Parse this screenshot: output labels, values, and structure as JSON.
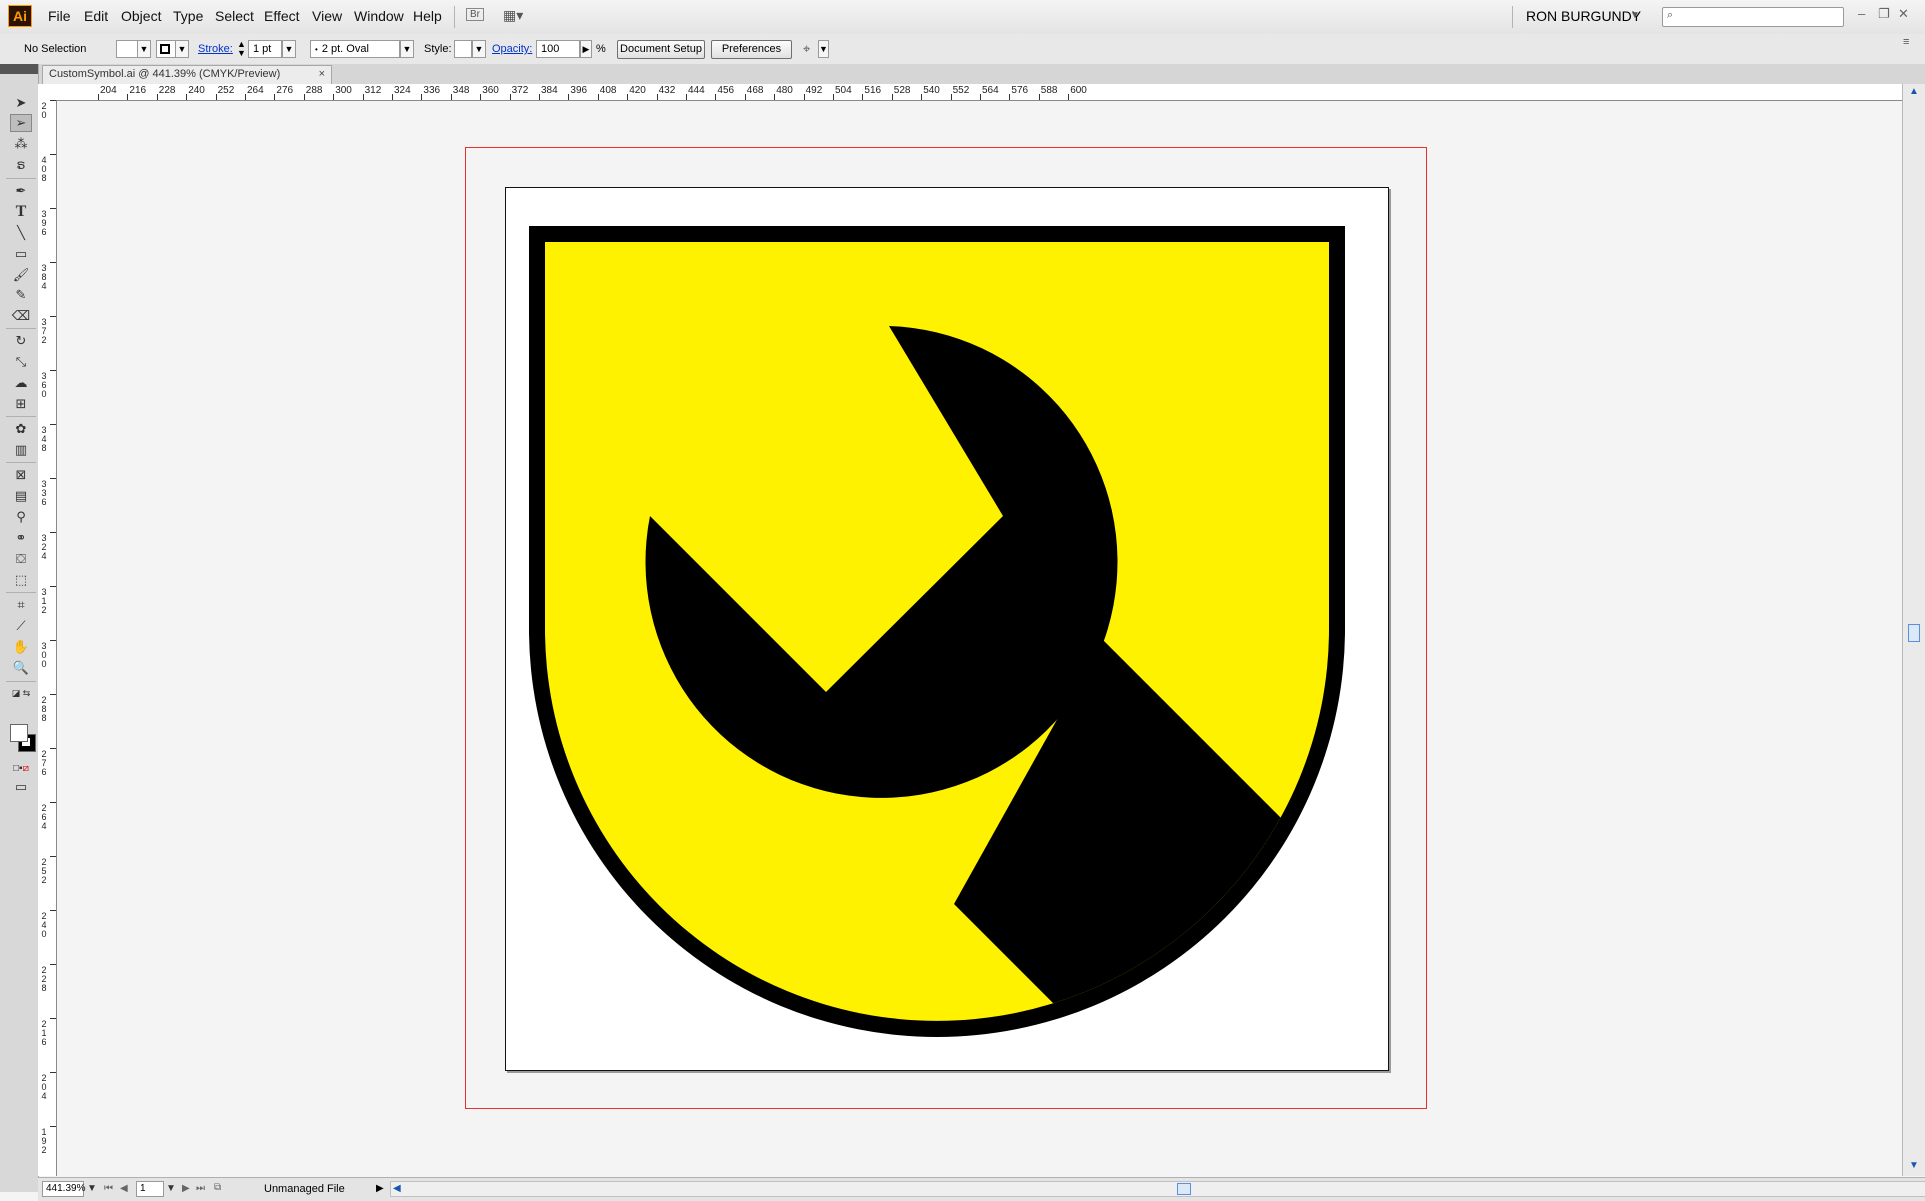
{
  "app": {
    "logo_text": "Ai",
    "menu": [
      "File",
      "Edit",
      "Object",
      "Type",
      "Select",
      "Effect",
      "View",
      "Window",
      "Help"
    ],
    "user_name": "RON BURGUNDY",
    "search_placeholder": ""
  },
  "control_bar": {
    "selection_label": "No Selection",
    "stroke_label": "Stroke:",
    "stroke_value": "1 pt",
    "brush_value": "2 pt. Oval",
    "style_label": "Style:",
    "opacity_label": "Opacity:",
    "opacity_value": "100",
    "percent": "%",
    "document_setup": "Document Setup",
    "preferences": "Preferences"
  },
  "document": {
    "tab_title": "CustomSymbol.ai @ 441.39% (CMYK/Preview)",
    "close_glyph": "×"
  },
  "ruler": {
    "h_ticks": [
      "204",
      "216",
      "228",
      "240",
      "252",
      "264",
      "276",
      "288",
      "300",
      "312",
      "324",
      "336",
      "348",
      "360",
      "372",
      "384",
      "396",
      "408",
      "420",
      "432",
      "444",
      "456",
      "468",
      "480",
      "492",
      "504",
      "516",
      "528",
      "540",
      "552",
      "564",
      "576",
      "588",
      "600"
    ],
    "v_ticks": [
      "20",
      "408",
      "396",
      "384",
      "372",
      "360",
      "348",
      "336",
      "324",
      "312",
      "300",
      "288",
      "276",
      "264",
      "252",
      "240",
      "228",
      "216",
      "204",
      "192"
    ]
  },
  "artwork": {
    "shield_fill": "#fff200",
    "outline_color": "#000000",
    "wrench_color": "#000000"
  },
  "status": {
    "zoom": "441.39%",
    "page": "1",
    "file_status": "Unmanaged File"
  },
  "icons": {
    "tools": [
      "selection-tool-icon",
      "direct-selection-tool-icon",
      "magic-wand-tool-icon",
      "lasso-tool-icon",
      "pen-tool-icon",
      "type-tool-icon",
      "line-tool-icon",
      "rectangle-tool-icon",
      "paintbrush-tool-icon",
      "pencil-tool-icon",
      "eraser-tool-icon",
      "rotate-tool-icon",
      "scale-tool-icon",
      "warp-tool-icon",
      "free-transform-tool-icon",
      "symbol-sprayer-tool-icon",
      "graph-tool-icon",
      "mesh-tool-icon",
      "gradient-tool-icon",
      "eyedropper-tool-icon",
      "blend-tool-icon",
      "live-paint-tool-icon",
      "live-paint-selection-tool-icon",
      "crop-tool-icon",
      "slice-tool-icon",
      "hand-tool-icon",
      "zoom-tool-icon"
    ]
  }
}
